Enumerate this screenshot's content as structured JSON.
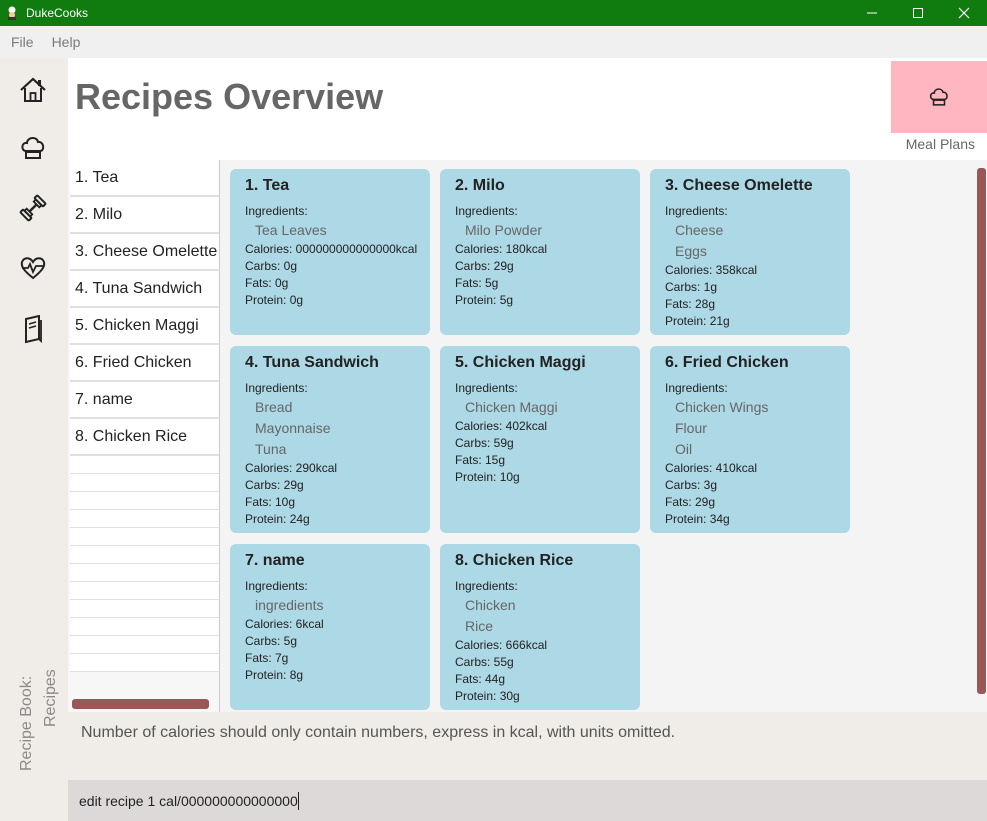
{
  "window": {
    "title": "DukeCooks"
  },
  "menu": [
    "File",
    "Help"
  ],
  "sidebar": {
    "vertical_label_1": "Recipe Book:",
    "vertical_label_2": "Recipes",
    "nav": [
      {
        "name": "home-icon"
      },
      {
        "name": "chef-hat-icon"
      },
      {
        "name": "dumbbell-icon"
      },
      {
        "name": "heartbeat-icon"
      },
      {
        "name": "book-icon"
      }
    ]
  },
  "header": {
    "title": "Recipes Overview",
    "meal_plans_label": "Meal Plans"
  },
  "recipe_list": [
    "1.  Tea",
    "2.  Milo",
    "3.  Cheese Omelette",
    "4.  Tuna Sandwich",
    "5.  Chicken Maggi",
    "6.  Fried Chicken",
    "7.  name",
    "8.  Chicken Rice"
  ],
  "cards": [
    {
      "title": "1.  Tea",
      "ingredients_label": "Ingredients:",
      "ingredients": [
        "Tea Leaves"
      ],
      "calories": "Calories: 000000000000000kcal",
      "carbs": "Carbs: 0g",
      "fats": "Fats: 0g",
      "protein": "Protein: 0g"
    },
    {
      "title": "2.  Milo",
      "ingredients_label": "Ingredients:",
      "ingredients": [
        "Milo Powder"
      ],
      "calories": "Calories: 180kcal",
      "carbs": "Carbs: 29g",
      "fats": "Fats: 5g",
      "protein": "Protein: 5g"
    },
    {
      "title": "3.  Cheese Omelette",
      "ingredients_label": "Ingredients:",
      "ingredients": [
        "Cheese",
        "Eggs"
      ],
      "calories": "Calories: 358kcal",
      "carbs": "Carbs: 1g",
      "fats": "Fats: 28g",
      "protein": "Protein: 21g"
    },
    {
      "title": "4.  Tuna Sandwich",
      "ingredients_label": "Ingredients:",
      "ingredients": [
        "Bread",
        "Mayonnaise",
        "Tuna"
      ],
      "calories": "Calories: 290kcal",
      "carbs": "Carbs: 29g",
      "fats": "Fats: 10g",
      "protein": "Protein: 24g"
    },
    {
      "title": "5.  Chicken Maggi",
      "ingredients_label": "Ingredients:",
      "ingredients": [
        "Chicken Maggi"
      ],
      "calories": "Calories: 402kcal",
      "carbs": "Carbs: 59g",
      "fats": "Fats: 15g",
      "protein": "Protein: 10g"
    },
    {
      "title": "6.  Fried Chicken",
      "ingredients_label": "Ingredients:",
      "ingredients": [
        "Chicken Wings",
        "Flour",
        "Oil"
      ],
      "calories": "Calories: 410kcal",
      "carbs": "Carbs: 3g",
      "fats": "Fats: 29g",
      "protein": "Protein: 34g"
    },
    {
      "title": "7.  name",
      "ingredients_label": "Ingredients:",
      "ingredients": [
        "ingredients"
      ],
      "calories": "Calories: 6kcal",
      "carbs": "Carbs: 5g",
      "fats": "Fats: 7g",
      "protein": "Protein: 8g"
    },
    {
      "title": "8.  Chicken Rice",
      "ingredients_label": "Ingredients:",
      "ingredients": [
        "Chicken",
        "Rice"
      ],
      "calories": "Calories: 666kcal",
      "carbs": "Carbs: 55g",
      "fats": "Fats: 44g",
      "protein": "Protein: 30g"
    }
  ],
  "result": {
    "message": "Number of calories should only contain numbers, express in kcal, with units omitted."
  },
  "command": {
    "value": "edit recipe 1 cal/000000000000000"
  },
  "colors": {
    "titlebar": "#107c10",
    "card": "#add8e6",
    "meal_plans": "#ffb6c1",
    "scrollbar": "#9a5757"
  }
}
